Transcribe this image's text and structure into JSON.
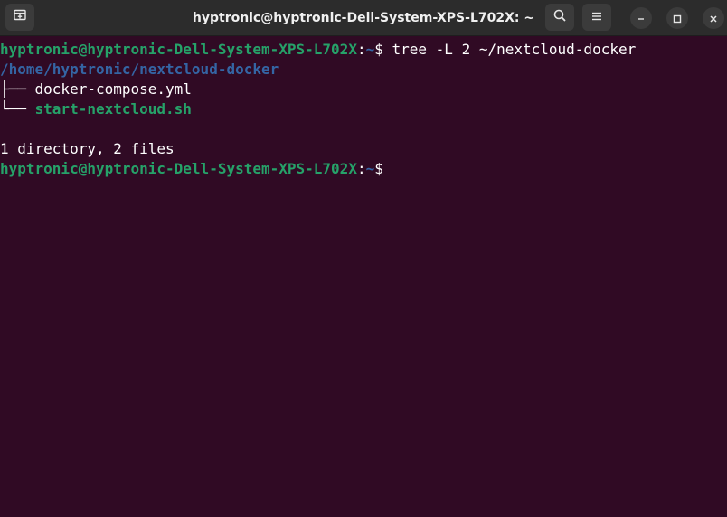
{
  "window": {
    "title": "hyptronic@hyptronic-Dell-System-XPS-L702X: ~"
  },
  "icons": {
    "new_tab": "new-tab-icon",
    "search": "search-icon",
    "menu": "hamburger-menu-icon",
    "minimize": "minimize-icon",
    "maximize": "maximize-icon",
    "close": "close-icon"
  },
  "colors": {
    "background": "#300a24",
    "prompt_green": "#26a269",
    "directory_blue": "#3465a4",
    "titlebar": "#2c2c2c"
  },
  "terminal": {
    "prompt_user": "hyptronic@hyptronic-Dell-System-XPS-L702X",
    "prompt_sep": ":",
    "prompt_path": "~",
    "prompt_symbol": "$",
    "command": " tree -L 2 ~/nextcloud-docker",
    "root_dir": "/home/hyptronic/nextcloud-docker",
    "tree_branch_1": "├── ",
    "file_1": "docker-compose.yml",
    "tree_branch_2": "└── ",
    "file_2": "start-nextcloud.sh",
    "summary": "1 directory, 2 files"
  }
}
